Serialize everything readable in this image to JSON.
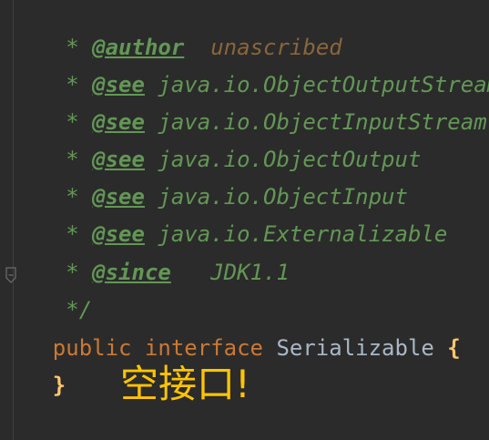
{
  "editor": {
    "doc_comment": {
      "lines": [
        {
          "prefix": " * ",
          "tag": "@author",
          "gap": "  ",
          "text": "unascribed",
          "text_type": "value"
        },
        {
          "prefix": " * ",
          "tag": "@see",
          "gap": " ",
          "text": "java.io.ObjectOutputStream",
          "text_type": "doc"
        },
        {
          "prefix": " * ",
          "tag": "@see",
          "gap": " ",
          "text": "java.io.ObjectInputStream",
          "text_type": "doc"
        },
        {
          "prefix": " * ",
          "tag": "@see",
          "gap": " ",
          "text": "java.io.ObjectOutput",
          "text_type": "doc"
        },
        {
          "prefix": " * ",
          "tag": "@see",
          "gap": " ",
          "text": "java.io.ObjectInput",
          "text_type": "doc"
        },
        {
          "prefix": " * ",
          "tag": "@see",
          "gap": " ",
          "text": "java.io.Externalizable",
          "text_type": "doc"
        },
        {
          "prefix": " * ",
          "tag": "@since",
          "gap": "   ",
          "text": "JDK1.1",
          "text_type": "doc"
        }
      ],
      "close": " */"
    },
    "declaration": {
      "modifier": "public",
      "keyword": "interface",
      "name": "Serializable",
      "open_brace": "{",
      "close_brace": "}"
    },
    "colors": {
      "background": "#2b2b2b",
      "keyword": "#cc7832",
      "doc_comment": "#629755",
      "identifier": "#a9b7c6",
      "brace": "#ffc66d",
      "annotation_text": "#ffc400"
    }
  },
  "annotation": {
    "text": "空接口!"
  }
}
